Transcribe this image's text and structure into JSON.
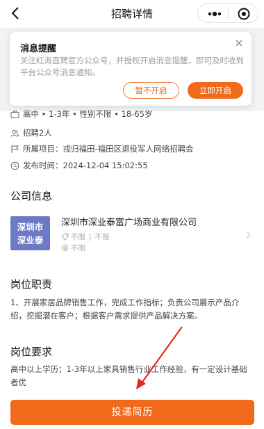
{
  "header": {
    "title": "招聘详情"
  },
  "notice": {
    "title": "消息提醒",
    "body": "关注红海直聘官方公众号，并授权开启消息提醒，即可及时收到平台公众号消息通知。",
    "later_label": "暂不开启",
    "open_label": "立即开启"
  },
  "job": {
    "requirements": "高中 • 1-3年 • 性别不限 • 18-65岁",
    "headcount": "招聘2人",
    "project": "所属项目：戎归福田-福田区退役军人网络招聘会",
    "publish_time": "发布时间：2024-12-04 15:02:55"
  },
  "company": {
    "section_title": "公司信息",
    "logo_line1": "深圳市",
    "logo_line2": "深业泰",
    "name": "深圳市深业泰富广场商业有限公司",
    "meta_industry": "不限",
    "meta_sep": "|",
    "meta_size": "不限",
    "meta_scale": "不限"
  },
  "duties": {
    "section_title": "岗位职责",
    "text": "1、开展家居品牌销售工作，完成工作指标；负责公司展示产品介绍，挖掘潜在客户；根据客户需求提供产品解决方案。"
  },
  "requirements_section": {
    "section_title": "岗位要求",
    "text": "高中以上学历；1-3年以上家具销售行业工作经验，有一定设计基础者优"
  },
  "footer": {
    "submit_label": "投递简历"
  },
  "colors": {
    "accent": "#f06a1a",
    "logo_bg": "#6d79c4",
    "annotation_arrow": "#e8281e"
  }
}
